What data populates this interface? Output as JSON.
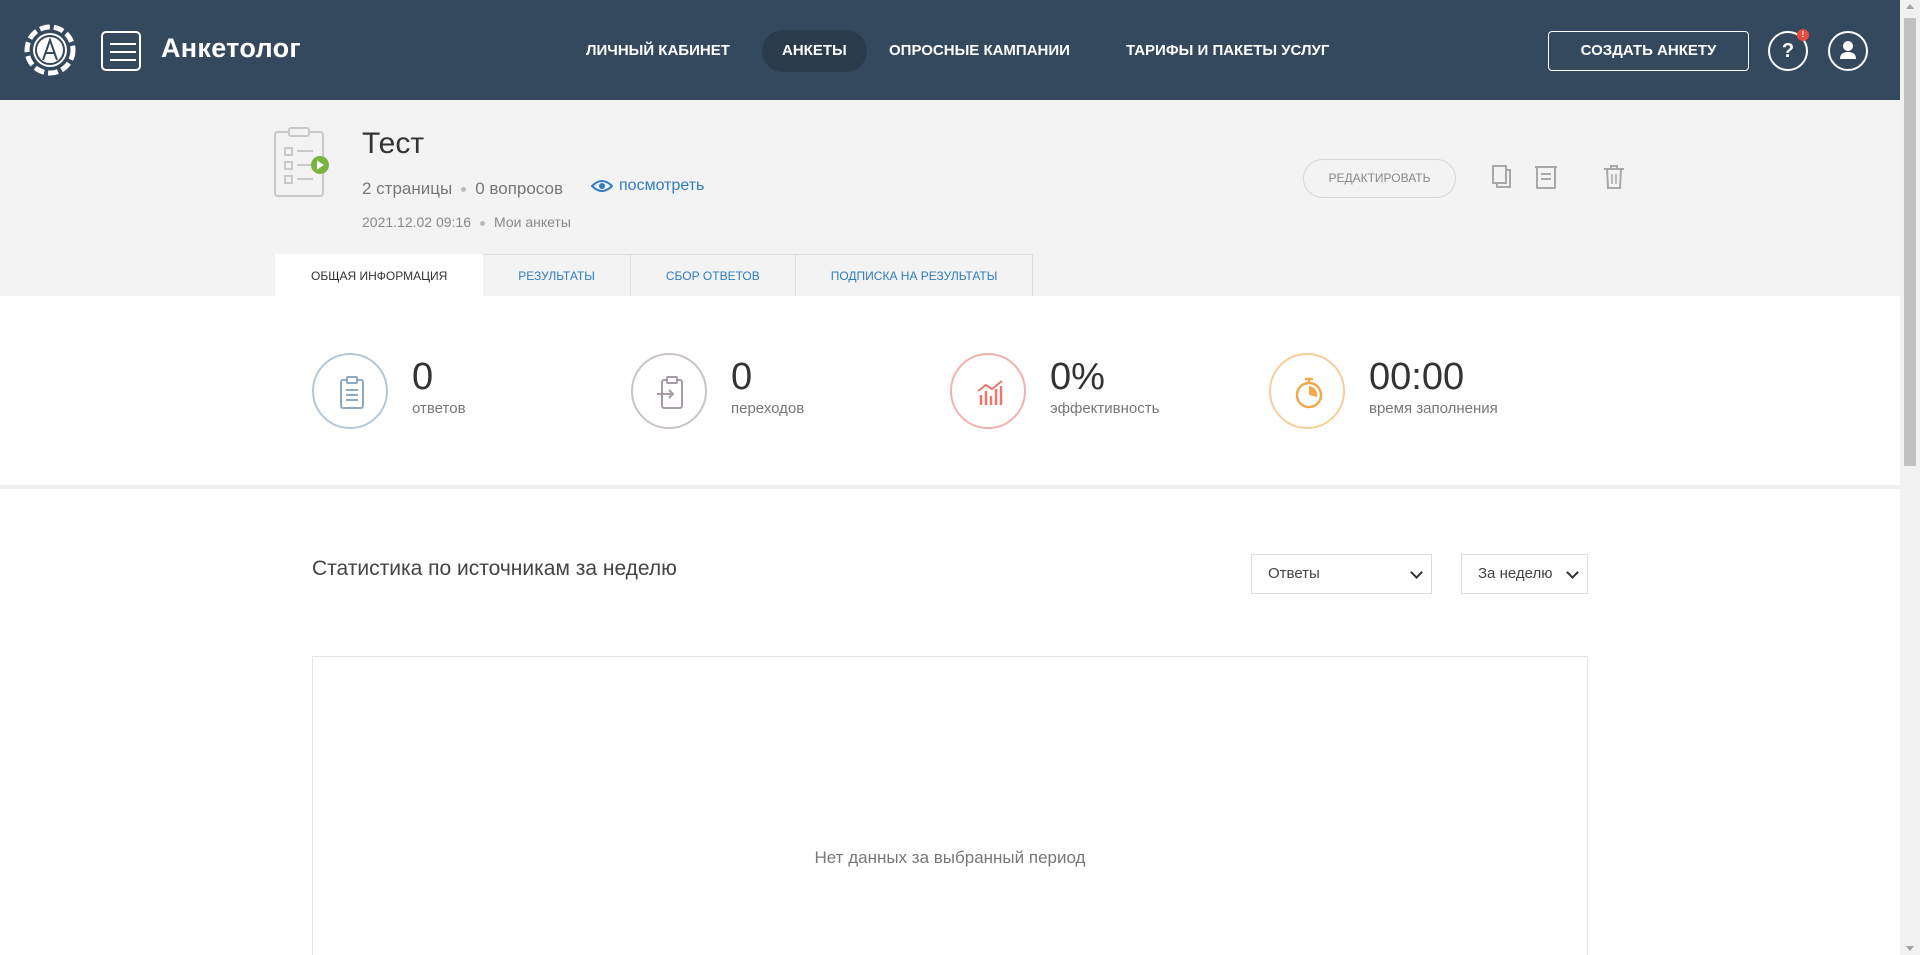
{
  "app": {
    "brand": "Анкетолог",
    "colors": {
      "topbar": "#34495e",
      "link": "#2e7cc2",
      "accent_green": "#7cb342"
    }
  },
  "nav": {
    "items": [
      {
        "label": "ЛИЧНЫЙ КАБИНЕТ",
        "active": false
      },
      {
        "label": "АНКЕТЫ",
        "active": true
      },
      {
        "label": "ОПРОСНЫЕ КАМПАНИИ",
        "active": false
      },
      {
        "label": "ТАРИФЫ И ПАКЕТЫ УСЛУГ",
        "active": false
      }
    ],
    "create_button": "СОЗДАТЬ АНКЕТУ",
    "help_label": "?",
    "notification_badge": "!"
  },
  "survey": {
    "title": "Тест",
    "pages": "2 страницы",
    "questions": "0 вопросов",
    "view_link": "посмотреть",
    "date": "2021.12.02 09:16",
    "folder": "Мои анкеты",
    "edit_button": "РЕДАКТИРОВАТЬ"
  },
  "tabs": [
    {
      "label": "ОБЩАЯ ИНФОРМАЦИЯ",
      "active": true
    },
    {
      "label": "РЕЗУЛЬТАТЫ",
      "active": false
    },
    {
      "label": "СБОР ОТВЕТОВ",
      "active": false
    },
    {
      "label": "ПОДПИСКА НА РЕЗУЛЬТАТЫ",
      "active": false
    }
  ],
  "stats": [
    {
      "value": "0",
      "label": "ответов",
      "icon": "clipboard-icon",
      "color": "#b4c8d8"
    },
    {
      "value": "0",
      "label": "переходов",
      "icon": "clipboard-enter-icon",
      "color": "#c9c2c9"
    },
    {
      "value": "0%",
      "label": "эффективность",
      "icon": "bar-chart-icon",
      "color": "#f2b1ab"
    },
    {
      "value": "00:00",
      "label": "время заполнения",
      "icon": "stopwatch-icon",
      "color": "#f7cd9b"
    }
  ],
  "sources": {
    "title": "Статистика по источникам за неделю",
    "metric_select": "Ответы",
    "period_select": "За неделю",
    "empty_message": "Нет данных за выбранный период"
  }
}
